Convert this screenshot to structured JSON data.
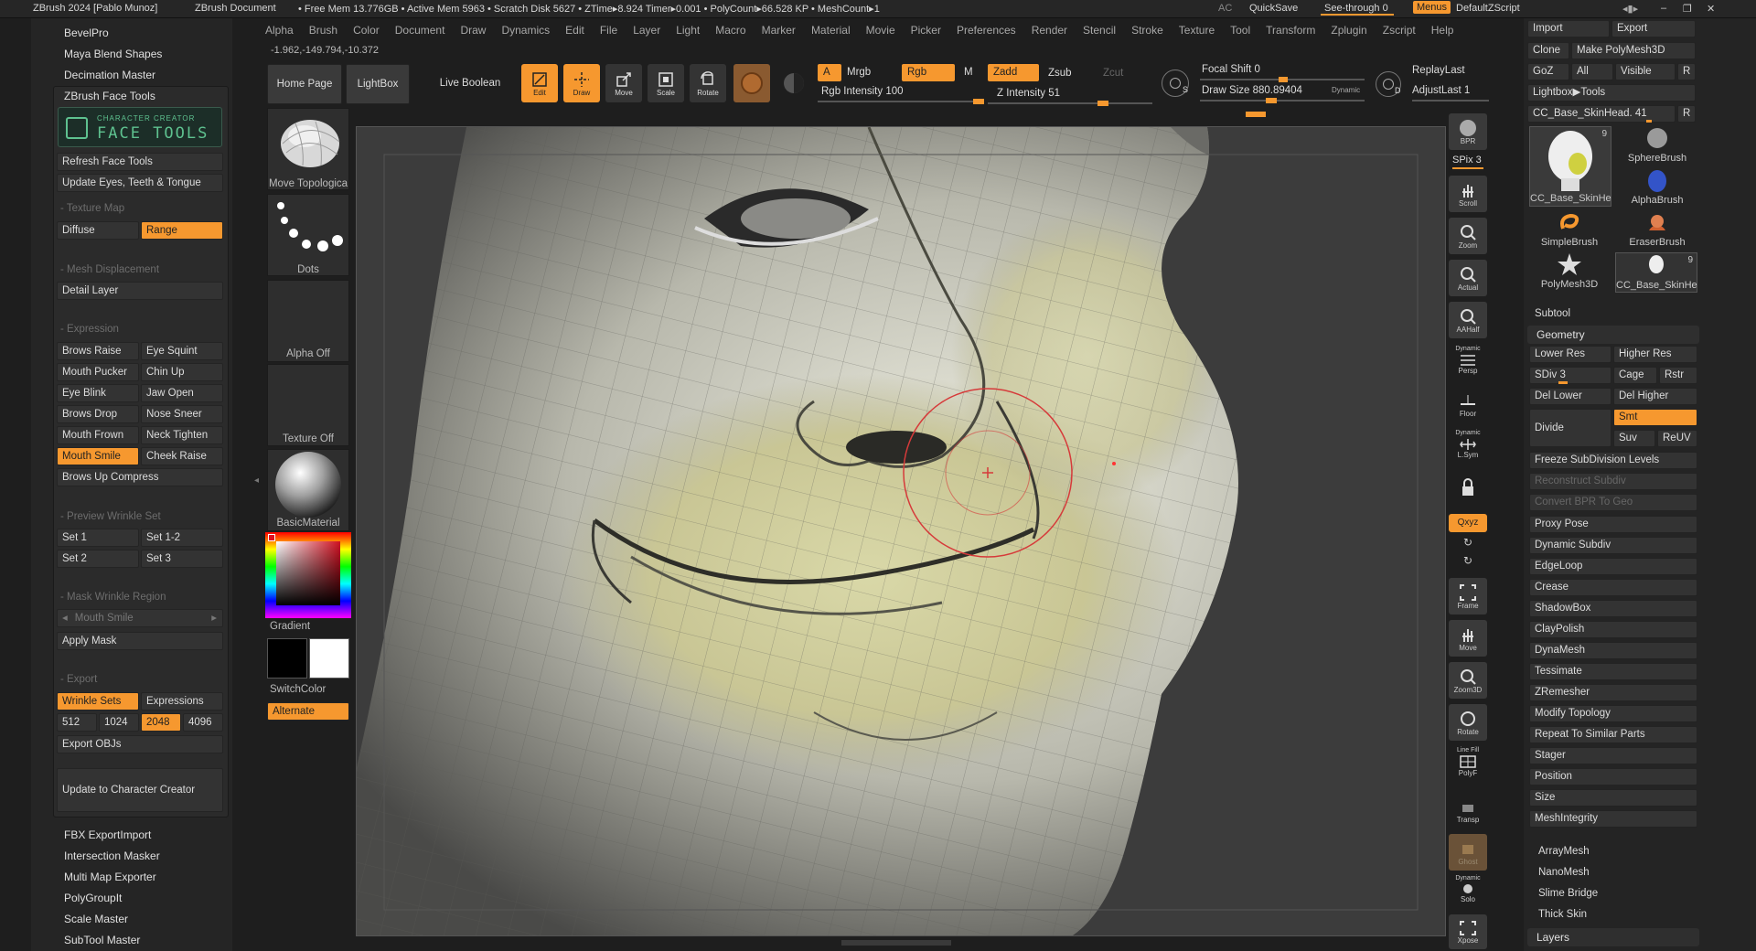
{
  "titlebar": {
    "app_title": "ZBrush 2024 [Pablo Munoz]",
    "doc": "ZBrush Document",
    "stats": "• Free Mem 13.776GB • Active Mem 5963 • Scratch Disk 5627 • ZTime▸8.924 Timer▸0.001 • PolyCount▸66.528 KP • MeshCount▸1",
    "ac": "AC",
    "quicksave": "QuickSave",
    "seethrough": "See-through",
    "seethrough_val": "0",
    "menus": "Menus",
    "script": "DefaultZScript"
  },
  "menu": [
    "Alpha",
    "Brush",
    "Color",
    "Document",
    "Draw",
    "Dynamics",
    "Edit",
    "File",
    "Layer",
    "Light",
    "Macro",
    "Marker",
    "Material",
    "Movie",
    "Picker",
    "Preferences",
    "Render",
    "Stencil",
    "Stroke",
    "Texture",
    "Tool",
    "Transform",
    "Zplugin",
    "Zscript",
    "Help"
  ],
  "coords": "-1.962,-149.794,-10.372",
  "plugins_top": [
    "BevelPro",
    "Maya Blend Shapes",
    "Decimation Master"
  ],
  "face_tools": {
    "header": "ZBrush Face Tools",
    "logo_line1": "CHARACTER CREATOR",
    "logo_line2": "FACE TOOLS",
    "refresh": "Refresh Face Tools",
    "update_eyes": "Update Eyes, Teeth & Tongue",
    "texture_map": "Texture Map",
    "diffuse": "Diffuse",
    "range": "Range",
    "mesh_disp": "Mesh Displacement",
    "detail_layer": "Detail Layer",
    "expression": "Expression",
    "expr_left": [
      "Brows Raise",
      "Mouth Pucker",
      "Eye Blink",
      "Brows Drop",
      "Mouth Frown",
      "Mouth Smile"
    ],
    "expr_right": [
      "Eye Squint",
      "Chin Up",
      "Jaw Open",
      "Nose Sneer",
      "Neck Tighten",
      "Cheek Raise"
    ],
    "brows_up": "Brows Up Compress",
    "preview_wrinkle": "Preview Wrinkle Set",
    "set1": "Set 1",
    "set12": "Set 1-2",
    "set2": "Set 2",
    "set3": "Set 3",
    "mask_wrinkle": "Mask Wrinkle Region",
    "mask_sel": "Mouth Smile",
    "apply_mask": "Apply Mask",
    "export": "Export",
    "wrinkle_sets": "Wrinkle Sets",
    "expressions": "Expressions",
    "sizes": [
      "512",
      "1024",
      "2048",
      "4096"
    ],
    "export_objs": "Export OBJs",
    "update_cc": "Update to Character Creator"
  },
  "plugins_bottom": [
    "FBX ExportImport",
    "Intersection Masker",
    "Multi Map Exporter",
    "PolyGroupIt",
    "Scale Master",
    "SubTool Master"
  ],
  "brush_col": {
    "move": "Move Topologica",
    "dots": "Dots",
    "alpha": "Alpha Off",
    "texture": "Texture Off",
    "material": "BasicMaterial",
    "gradient": "Gradient",
    "switch": "SwitchColor",
    "alternate": "Alternate"
  },
  "toolbar": {
    "home": "Home Page",
    "lightbox": "LightBox",
    "live_boolean": "Live Boolean",
    "edit": "Edit",
    "draw": "Draw",
    "move": "Move",
    "scale": "Scale",
    "rotate": "Rotate",
    "a": "A",
    "mrgb": "Mrgb",
    "rgb": "Rgb",
    "m": "M",
    "rgb_intensity": "Rgb Intensity 100",
    "zadd": "Zadd",
    "zsub": "Zsub",
    "zcut": "Zcut",
    "z_intensity": "Z Intensity 51",
    "focal": "Focal Shift 0",
    "drawsize": "Draw Size 880.89404",
    "dynamic": "Dynamic",
    "replay": "ReplayLast",
    "adjust": "AdjustLast 1"
  },
  "nav": {
    "bpr": "BPR",
    "spix": "SPix 3",
    "scroll": "Scroll",
    "zoom": "Zoom",
    "actual": "Actual",
    "aahalf": "AAHalf",
    "dynamic": "Dynamic",
    "persp": "Persp",
    "floor": "Floor",
    "lsym": "L.Sym",
    "xyz": "Qxyz",
    "frame": "Frame",
    "move": "Move",
    "zoom3d": "Zoom3D",
    "rotate": "Rotate",
    "linefill": "Line Fill",
    "polyf": "PolyF",
    "transp": "Transp",
    "ghost": "Ghost",
    "solo": "Solo",
    "xpose": "Xpose"
  },
  "right": {
    "import": "Import",
    "export": "Export",
    "clone": "Clone",
    "make_poly": "Make PolyMesh3D",
    "goz": "GoZ",
    "all": "All",
    "visible": "Visible",
    "r": "R",
    "lightbox_tools": "Lightbox▶Tools",
    "skinhead": "CC_Base_SkinHead. 41",
    "tools": [
      "CC_Base_SkinHe",
      "SphereBrush",
      "AlphaBrush",
      "SimpleBrush",
      "EraserBrush",
      "PolyMesh3D",
      "CC_Base_SkinHe"
    ],
    "count9": "9",
    "subtool": "Subtool",
    "geometry": "Geometry",
    "lower": "Lower Res",
    "higher": "Higher Res",
    "sdiv": "SDiv 3",
    "cage": "Cage",
    "rstr": "Rstr",
    "del_lower": "Del Lower",
    "del_higher": "Del Higher",
    "divide": "Divide",
    "smt": "Smt",
    "suv": "Suv",
    "reuv": "ReUV",
    "freeze": "Freeze SubDivision Levels",
    "reconstruct": "Reconstruct Subdiv",
    "convert": "Convert BPR To Geo",
    "geo_items": [
      "Proxy Pose",
      "Dynamic Subdiv",
      "EdgeLoop",
      "Crease",
      "ShadowBox",
      "ClayPolish",
      "DynaMesh",
      "Tessimate",
      "ZRemesher",
      "Modify Topology",
      "Repeat To Similar Parts",
      "Stager",
      "Position",
      "Size",
      "MeshIntegrity"
    ],
    "bottom_items": [
      "ArrayMesh",
      "NanoMesh",
      "Slime Bridge",
      "Thick Skin"
    ],
    "layers": "Layers"
  }
}
